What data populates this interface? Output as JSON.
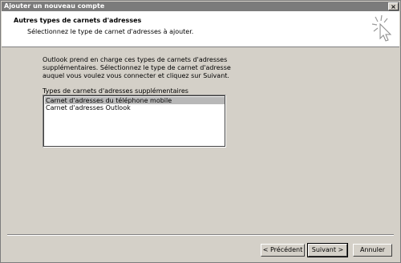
{
  "window": {
    "title": "Ajouter un nouveau compte",
    "close_glyph": "×"
  },
  "header": {
    "title": "Autres types de carnets d'adresses",
    "subtitle": "Sélectionnez le type de carnet d'adresses à ajouter."
  },
  "body": {
    "description": "Outlook prend en charge ces types de carnets d'adresses supplémentaires. Sélectionnez le type de carnet d'adresse auquel vous voulez vous connecter et cliquez sur Suivant.",
    "list_label": "Types de carnets d'adresses supplémentaires",
    "list_items": [
      "Carnet d'adresses du téléphone mobile",
      "Carnet d'adresses Outlook"
    ],
    "selected_index": 0
  },
  "buttons": {
    "back": "< Précédent",
    "next": "Suivant >",
    "cancel": "Annuler"
  },
  "icons": {
    "header_icon": "sparkle-cursor-icon"
  }
}
